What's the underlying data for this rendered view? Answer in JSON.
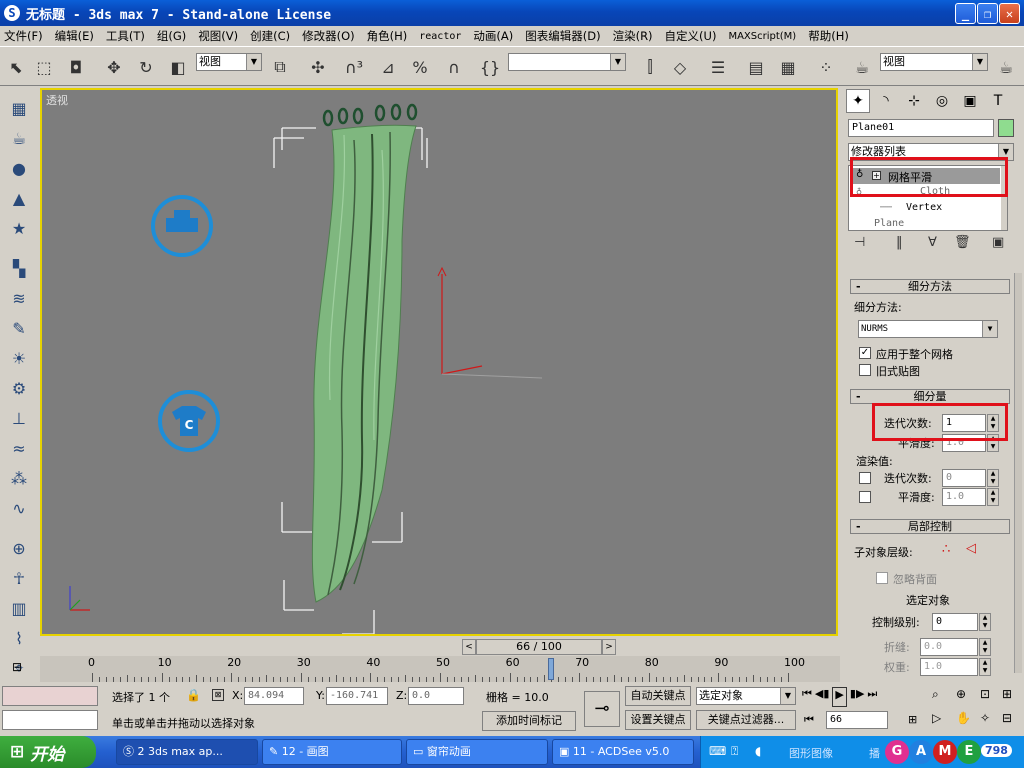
{
  "window": {
    "title": "无标题  - 3ds max 7  - Stand-alone License",
    "app_icon": "3ds-max-icon"
  },
  "menu": [
    "文件(F)",
    "编辑(E)",
    "工具(T)",
    "组(G)",
    "视图(V)",
    "创建(C)",
    "修改器(O)",
    "角色(H)",
    "reactor",
    "动画(A)",
    "图表编辑器(D)",
    "渲染(R)",
    "自定义(U)",
    "MAXScript(M)",
    "帮助(H)"
  ],
  "toolbar": {
    "refcoord": "视图",
    "selection_set": "",
    "view_dropdown": "视图"
  },
  "viewport": {
    "label": "透视",
    "object_color": "#7fb77f",
    "select_color": "#e6d200"
  },
  "rpanel": {
    "object_name": "Plane01",
    "object_color": "#8fdc8f",
    "modifier_list": "修改器列表",
    "stack": [
      "网格平滑",
      "Cloth",
      "Vertex",
      "Plane"
    ],
    "stack_obscured": [
      "Cloth",
      "Plane"
    ],
    "subdiv_method_header": "细分方法",
    "subdiv_method_label": "细分方法:",
    "subdiv_method_value": "NURMS",
    "apply_whole": "应用于整个网格",
    "apply_whole_checked": true,
    "old_mapping": "旧式贴图",
    "amount_header": "细分量",
    "iterations_label": "迭代次数:",
    "iterations_value": "1",
    "smoothness_label": "平滑度:",
    "smoothness_value": "1.0",
    "render_values_label": "渲染值:",
    "render_iter_label": "迭代次数:",
    "render_iter_value": "0",
    "render_smooth_label": "平滑度:",
    "render_smooth_value": "1.0",
    "local_header": "局部控制",
    "sublevel_label": "子对象层级:",
    "ignore_backface": "忽略背面",
    "selected_obj": "选定对象",
    "control_level_label": "控制级别:",
    "control_level_value": "0",
    "crease_label": "折缝:",
    "crease_value": "0.0",
    "weight_label": "权重:",
    "weight_value": "1.0"
  },
  "timeline": {
    "frame": "66 / 100",
    "ticks": [
      "0",
      "10",
      "20",
      "30",
      "40",
      "50",
      "60",
      "70",
      "80",
      "90",
      "100"
    ],
    "progress": 0.66
  },
  "status": {
    "selected": "选择了 1 个",
    "x_label": "X:",
    "x_value": "84.094",
    "y_label": "Y:",
    "y_value": "-160.741",
    "z_label": "Z:",
    "z_value": "0.0",
    "grid": "栅格 = 10.0",
    "auto_key": "自动关键点",
    "set_key": "设置关键点",
    "selected_objects": "选定对象",
    "key_filters": "关键点过滤器...",
    "prompt": "单击或单击并拖动以选择对象",
    "add_time_tag": "添加时间标记",
    "current_frame": "66"
  },
  "taskbar": {
    "start": "开始",
    "tasks": [
      "2 3ds max ap...",
      "12 - 画图",
      "窗帘动画",
      "11 - ACDSee v5.0"
    ],
    "tray_text": "图形图像",
    "tray_tail": "播",
    "game_letters": [
      "G",
      "A",
      "M",
      "E"
    ],
    "game_num": "798"
  }
}
